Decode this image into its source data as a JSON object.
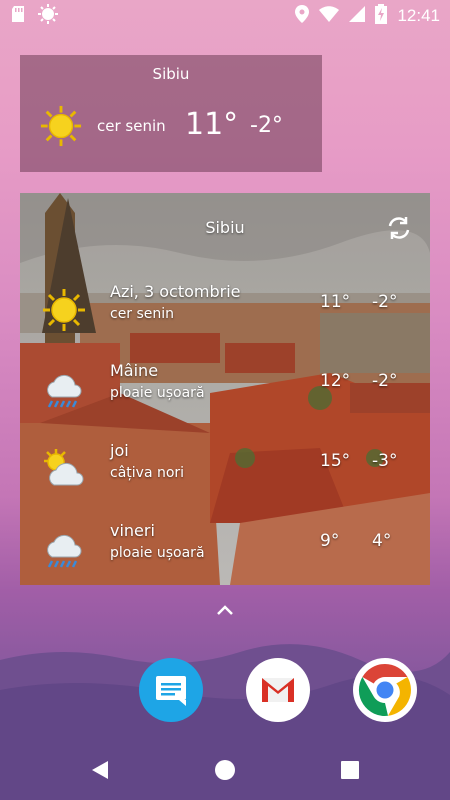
{
  "status_bar": {
    "time": "12:41",
    "icons": [
      "sd-card-icon",
      "settings-sun-icon",
      "location-icon",
      "wifi-icon",
      "battery-charging-icon"
    ]
  },
  "small_widget": {
    "city": "Sibiu",
    "description": "cer senin",
    "temp_max": "11°",
    "temp_min": "-2°",
    "icon": "sun-icon"
  },
  "large_widget": {
    "city": "Sibiu",
    "days": [
      {
        "name": "Azi, 3 octombrie",
        "description": "cer senin",
        "max": "11°",
        "min": "-2°",
        "icon": "sun-icon"
      },
      {
        "name": "Mâine",
        "description": "ploaie ușoară",
        "max": "12°",
        "min": "-2°",
        "icon": "rain-cloud-icon"
      },
      {
        "name": "joi",
        "description": "câțiva nori",
        "max": "15°",
        "min": "-3°",
        "icon": "partly-cloudy-icon"
      },
      {
        "name": "vineri",
        "description": "ploaie ușoară",
        "max": "9°",
        "min": "4°",
        "icon": "rain-cloud-icon"
      }
    ]
  },
  "dock": {
    "apps": [
      "messages-icon",
      "gmail-icon",
      "chrome-icon"
    ]
  },
  "colors": {
    "sun": "#f6d21e",
    "sun_ray": "#e8b800",
    "cloud": "#e8eef2",
    "rain": "#3b8ad9",
    "messages_blue": "#1ea5e6",
    "gmail_red": "#d93025",
    "chrome_red": "#db4437",
    "chrome_yellow": "#f4b400",
    "chrome_green": "#0f9d58",
    "chrome_blue": "#4285f4"
  }
}
